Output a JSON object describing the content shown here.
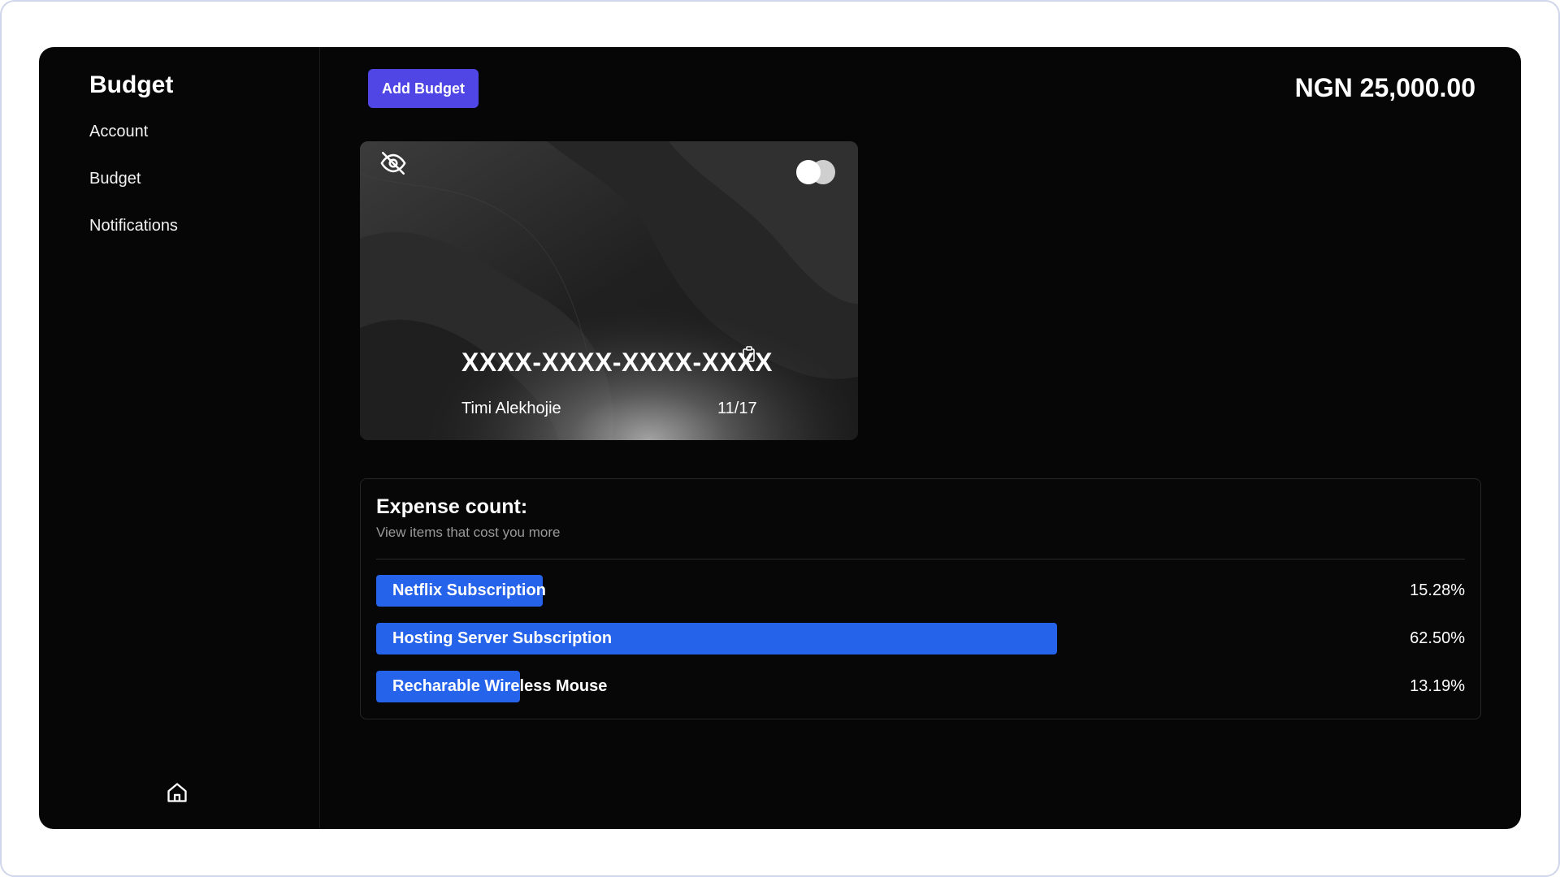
{
  "sidebar": {
    "title": "Budget",
    "items": [
      {
        "label": "Account"
      },
      {
        "label": "Budget"
      },
      {
        "label": "Notifications"
      }
    ],
    "footer_icon": "home-icon"
  },
  "header": {
    "add_budget_label": "Add Budget",
    "balance": "NGN 25,000.00"
  },
  "card": {
    "number": "XXXX-XXXX-XXXX-XXXX",
    "holder": "Timi Alekhojie",
    "expiry": "11/17",
    "icons": [
      "eye-off-icon",
      "copy-icon",
      "card-brand-icon"
    ]
  },
  "expenses": {
    "title": "Expense count:",
    "subtitle": "View items that cost you more",
    "items": [
      {
        "label": "Netflix Subscription",
        "percent_text": "15.28%",
        "fill_percent": 15.28
      },
      {
        "label": "Hosting Server Subscription",
        "percent_text": "62.50%",
        "fill_percent": 62.5
      },
      {
        "label": "Recharable Wireless Mouse",
        "percent_text": "13.19%",
        "fill_percent": 13.19
      }
    ]
  },
  "colors": {
    "accent_button": "#4f46e5",
    "bar_fill": "#2563eb",
    "background": "#060606"
  }
}
